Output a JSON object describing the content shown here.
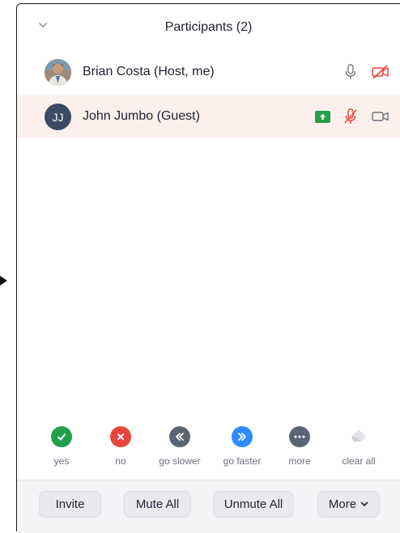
{
  "header": {
    "title": "Participants (2)"
  },
  "participants": [
    {
      "name": "Brian Costa (Host, me)",
      "avatar_type": "photo",
      "mic_icon": "microphone-icon",
      "video_icon": "video-off-icon",
      "video_status_color": "#e8453c"
    },
    {
      "name": "John Jumbo (Guest)",
      "initials": "JJ",
      "avatar_color": "#3a4b63",
      "share_icon": "screen-share-icon",
      "share_color": "#23a04a",
      "mic_icon": "microphone-muted-icon",
      "mic_status_color": "#e8453c",
      "video_icon": "video-camera-icon",
      "highlight_color": "#fdf0ec"
    }
  ],
  "reactions": [
    {
      "label": "yes",
      "icon": "check-icon",
      "color": "#23a04a"
    },
    {
      "label": "no",
      "icon": "x-icon",
      "color": "#e8453c"
    },
    {
      "label": "go slower",
      "icon": "rewind-icon",
      "color": "#5b6474"
    },
    {
      "label": "go faster",
      "icon": "fast-forward-icon",
      "color": "#2d8cff"
    },
    {
      "label": "more",
      "icon": "more-dots-icon",
      "color": "#5b6474"
    },
    {
      "label": "clear all",
      "icon": "eraser-icon",
      "color": "#d5d5da"
    }
  ],
  "footer": {
    "invite": "Invite",
    "mute_all": "Mute All",
    "unmute_all": "Unmute All",
    "more": "More"
  }
}
